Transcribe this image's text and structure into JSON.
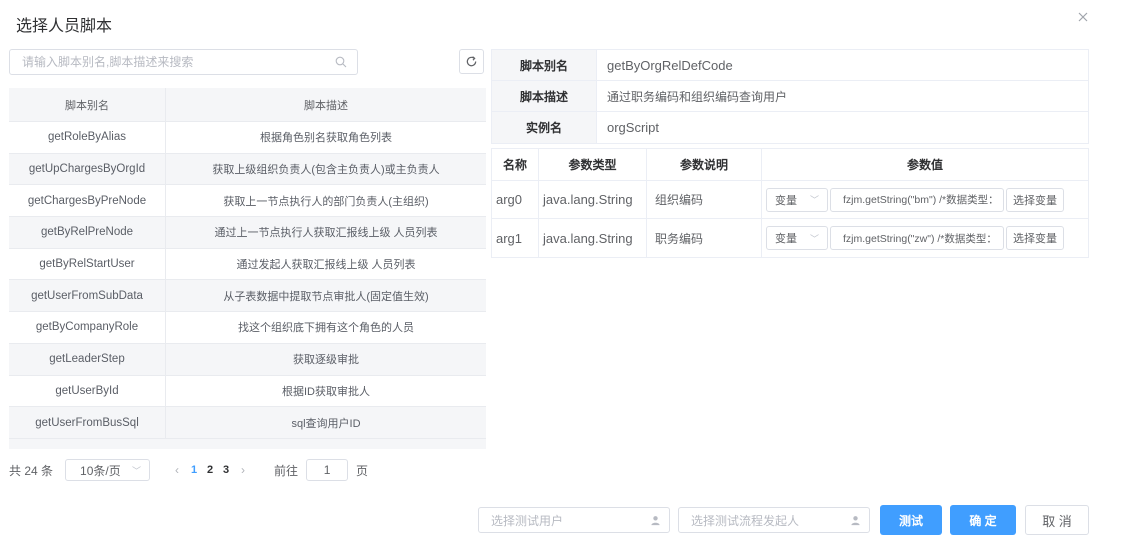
{
  "dialog": {
    "title": "选择人员脚本"
  },
  "search": {
    "placeholder": "请输入脚本别名,脚本描述来搜索"
  },
  "script_table": {
    "headers": [
      "脚本别名",
      "脚本描述"
    ],
    "rows": [
      [
        "getRoleByAlias",
        "根据角色别名获取角色列表"
      ],
      [
        "getUpChargesByOrgId",
        "获取上级组织负责人(包含主负责人)或主负责人"
      ],
      [
        "getChargesByPreNode",
        "获取上一节点执行人的部门负责人(主组织)"
      ],
      [
        "getByRelPreNode",
        "通过上一节点执行人获取汇报线上级 人员列表"
      ],
      [
        "getByRelStartUser",
        "通过发起人获取汇报线上级 人员列表"
      ],
      [
        "getUserFromSubData",
        "从子表数据中提取节点审批人(固定值生效)"
      ],
      [
        "getByCompanyRole",
        "找这个组织底下拥有这个角色的人员"
      ],
      [
        "getLeaderStep",
        "获取逐级审批"
      ],
      [
        "getUserById",
        "根据ID获取审批人"
      ],
      [
        "getUserFromBusSql",
        "sql查询用户ID"
      ]
    ]
  },
  "pagination": {
    "total": "共 24 条",
    "page_size": "10条/页",
    "prev": "‹",
    "pages": [
      "1",
      "2",
      "3"
    ],
    "current": "1",
    "next": "›",
    "goto_label": "前往",
    "goto_value": "1",
    "goto_unit": "页"
  },
  "script_info": {
    "alias_label": "脚本别名",
    "alias_value": "getByOrgRelDefCode",
    "desc_label": "脚本描述",
    "desc_value": "通过职务编码和组织编码查询用户",
    "instance_label": "实例名",
    "instance_value": "orgScript"
  },
  "params_table": {
    "headers": [
      "名称",
      "参数类型",
      "参数说明",
      "参数值"
    ],
    "rows": [
      {
        "name": "arg0",
        "type": "java.lang.String",
        "desc": "组织编码",
        "mode": "变量",
        "expr": "fzjm.getString(\"bm\") /*数据类型：",
        "pick": "选择变量"
      },
      {
        "name": "arg1",
        "type": "java.lang.String",
        "desc": "职务编码",
        "mode": "变量",
        "expr": "fzjm.getString(\"zw\") /*数据类型：",
        "pick": "选择变量"
      }
    ]
  },
  "footer": {
    "test_user_placeholder": "选择测试用户",
    "test_starter_placeholder": "选择测试流程发起人",
    "test_label": "测试",
    "confirm_label": "确 定",
    "cancel_label": "取 消"
  },
  "colors": {
    "primary": "#409eff",
    "border": "#dcdfe6",
    "stripe": "#f5f6f8"
  }
}
